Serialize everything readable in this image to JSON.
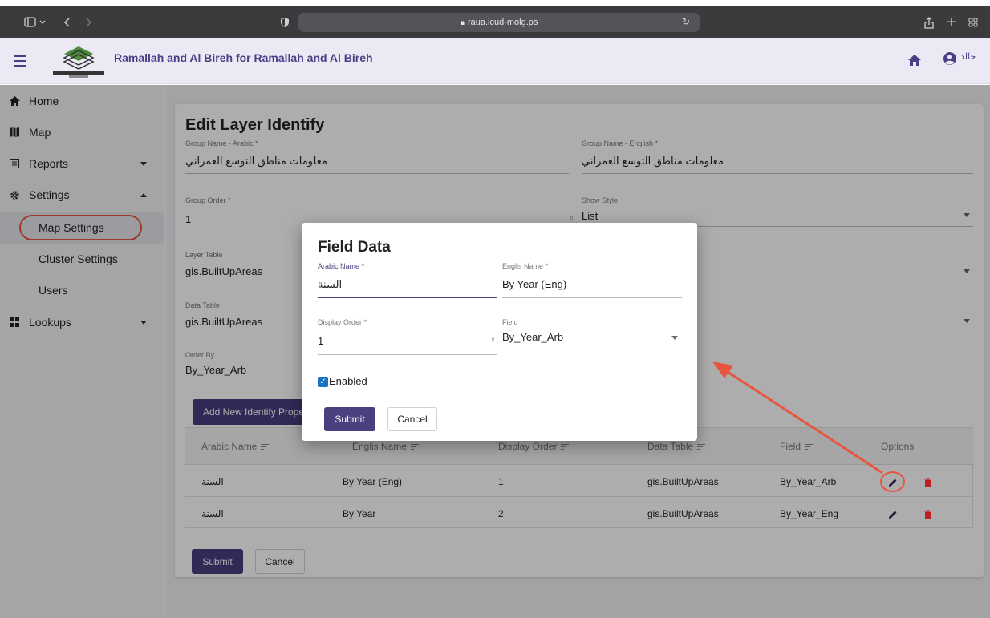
{
  "browser": {
    "url": "raua.icud-molg.ps"
  },
  "app": {
    "title": "Ramallah and Al Bireh for Ramallah and Al Bireh",
    "user_name": "خالد"
  },
  "sidebar": {
    "items": [
      {
        "label": "Home",
        "icon": "home-icon"
      },
      {
        "label": "Map",
        "icon": "map-icon"
      },
      {
        "label": "Reports",
        "icon": "reports-icon"
      },
      {
        "label": "Settings",
        "icon": "gear-icon"
      },
      {
        "label": "Lookups",
        "icon": "grid-icon"
      }
    ],
    "settings_sub": [
      {
        "label": "Map Settings"
      },
      {
        "label": "Cluster Settings"
      },
      {
        "label": "Users"
      }
    ]
  },
  "page": {
    "title": "Edit Layer Identify",
    "group_name_arabic_label": "Group Name - Arabic *",
    "group_name_arabic_value": "معلومات مناطق التوسع العمراني",
    "group_name_english_label": "Group Name - English *",
    "group_name_english_value": "معلومات مناطق التوسع العمراني",
    "group_order_label": "Group Order *",
    "group_order_value": "1",
    "show_style_label": "Show Style",
    "show_style_value": "List",
    "layer_table_label": "Layer Table",
    "layer_table_value": "gis.BuiltUpAreas",
    "data_table_label": "Data Table",
    "data_table_value": "gis.BuiltUpAreas",
    "order_by_label": "Order By",
    "order_by_value": "By_Year_Arb",
    "add_button": "Add New Identify Prope",
    "submit": "Submit",
    "cancel": "Cancel"
  },
  "table": {
    "headers": [
      "Arabic Name",
      "Englis Name",
      "Display Order",
      "Data Table",
      "Field",
      "Options"
    ],
    "rows": [
      [
        "السنة",
        "By Year (Eng)",
        "1",
        "gis.BuiltUpAreas",
        "By_Year_Arb"
      ],
      [
        "السنة",
        "By Year",
        "2",
        "gis.BuiltUpAreas",
        "By_Year_Eng"
      ]
    ]
  },
  "modal": {
    "title": "Field Data",
    "arabic_name_label": "Arabic Name *",
    "arabic_name_value": "السنة",
    "english_name_label": "Englis Name *",
    "english_name_value": "By Year (Eng)",
    "display_order_label": "Display Order *",
    "display_order_value": "1",
    "field_label": "Field",
    "field_value": "By_Year_Arb",
    "enabled_label": "Enabled",
    "submit": "Submit",
    "cancel": "Cancel"
  },
  "colors": {
    "primary": "#4b3f7f",
    "annotation": "#e8553e",
    "delete": "#d32f2f"
  }
}
